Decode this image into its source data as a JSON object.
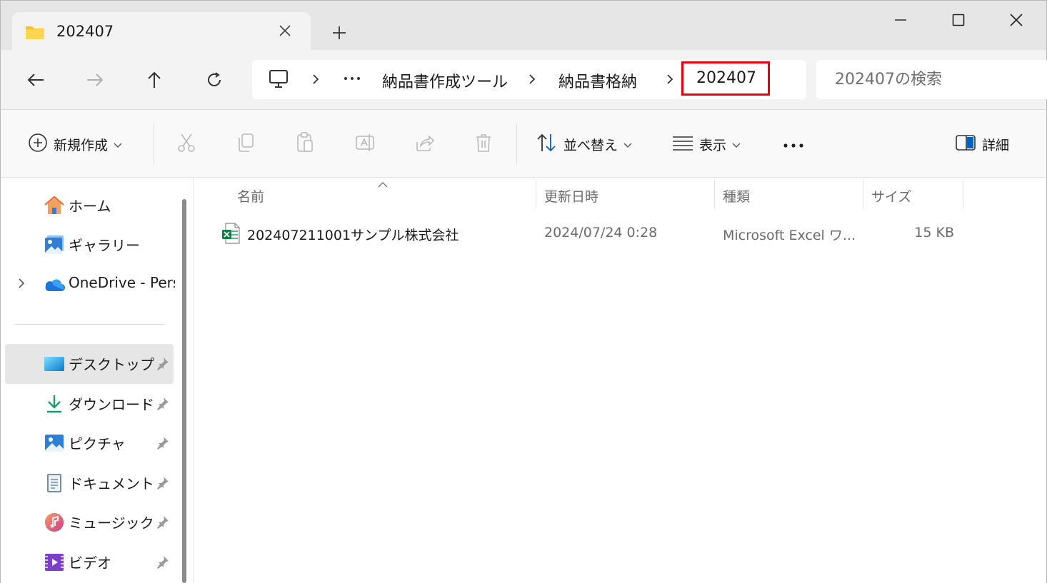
{
  "window": {
    "tab_title": "202407",
    "icons": {
      "tab": "folder-icon",
      "close_tab": "close-icon",
      "new_tab": "plus-icon"
    }
  },
  "nav": {
    "breadcrumb": [
      "納品書作成ツール",
      "納品書格納",
      "202407"
    ],
    "search_placeholder": "202407の検索",
    "highlight_color": "#e5000f"
  },
  "commands": {
    "new": "新規作成",
    "sort": "並べ替え",
    "view": "表示",
    "details": "詳細"
  },
  "sidebar": {
    "items": [
      {
        "label": "ホーム",
        "icon": "home-icon"
      },
      {
        "label": "ギャラリー",
        "icon": "gallery-icon"
      },
      {
        "label": "OneDrive - Personal",
        "icon": "onedrive-icon"
      },
      {
        "label": "デスクトップ",
        "icon": "desktop-icon"
      },
      {
        "label": "ダウンロード",
        "icon": "download-icon"
      },
      {
        "label": "ピクチャ",
        "icon": "pictures-icon"
      },
      {
        "label": "ドキュメント",
        "icon": "documents-icon"
      },
      {
        "label": "ミュージック",
        "icon": "music-icon"
      },
      {
        "label": "ビデオ",
        "icon": "video-icon"
      }
    ]
  },
  "filelist": {
    "columns": [
      "名前",
      "更新日時",
      "種類",
      "サイズ"
    ],
    "rows": [
      {
        "name": "202407211001サンプル株式会社",
        "modified": "2024/07/24 0:28",
        "type": "Microsoft Excel ワ...",
        "size": "15 KB",
        "icon": "excel-file-icon"
      }
    ]
  }
}
